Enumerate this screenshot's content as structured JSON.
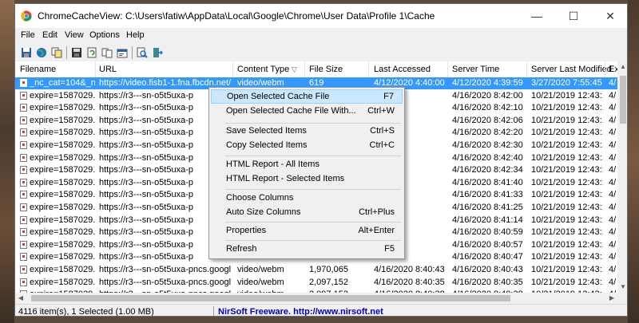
{
  "window": {
    "title": "ChromeCacheView:  C:\\Users\\fatiw\\AppData\\Local\\Google\\Chrome\\User Data\\Profile 1\\Cache"
  },
  "title_buttons": {
    "minimize": "—",
    "maximize": "☐",
    "close": "✕"
  },
  "menubar": [
    "File",
    "Edit",
    "View",
    "Options",
    "Help"
  ],
  "toolbar": [
    "save-icon",
    "globe-icon",
    "copy-icon",
    "disk-icon",
    "refresh-icon",
    "page-copy-icon",
    "properties-icon",
    "search-icon",
    "exit-icon"
  ],
  "columns": [
    "Filename",
    "URL",
    "Content Type",
    "File Size",
    "Last Accessed",
    "Server Time",
    "Server Last Modified",
    "Ex"
  ],
  "rows": [
    {
      "filename": "_nc_cat=104&_n...",
      "url": "https://video.fisb1-1.fna.fbcdn.net/...",
      "type": "video/webm",
      "size": "619",
      "accessed": "4/12/2020 4:40:00 ...",
      "server": "4/12/2020 4:39:59 ...",
      "modified": "3/27/2020 7:55:45 ...",
      "ex": "4/"
    },
    {
      "filename": "expire=1587029...",
      "url": "https://r3---sn-o5t5uxa-p",
      "type": "",
      "size": "",
      "accessed": "",
      "server": "4/16/2020 8:42:00 ...",
      "modified": "10/21/2019 12:43:1...",
      "ex": "4/"
    },
    {
      "filename": "expire=1587029...",
      "url": "https://r3---sn-o5t5uxa-p",
      "type": "",
      "size": "",
      "accessed": "",
      "server": "4/16/2020 8:42:10 ...",
      "modified": "10/21/2019 12:43:1...",
      "ex": "4/"
    },
    {
      "filename": "expire=1587029...",
      "url": "https://r3---sn-o5t5uxa-p",
      "type": "",
      "size": "",
      "accessed": "",
      "server": "4/16/2020 8:42:06 ...",
      "modified": "10/21/2019 12:43:1...",
      "ex": "4/"
    },
    {
      "filename": "expire=1587029...",
      "url": "https://r3---sn-o5t5uxa-p",
      "type": "",
      "size": "",
      "accessed": "",
      "server": "4/16/2020 8:42:20 ...",
      "modified": "10/21/2019 12:43:1...",
      "ex": "4/"
    },
    {
      "filename": "expire=1587029...",
      "url": "https://r3---sn-o5t5uxa-p",
      "type": "",
      "size": "",
      "accessed": "",
      "server": "4/16/2020 8:42:30 ...",
      "modified": "10/21/2019 12:43:1...",
      "ex": "4/"
    },
    {
      "filename": "expire=1587029...",
      "url": "https://r3---sn-o5t5uxa-p",
      "type": "",
      "size": "",
      "accessed": "",
      "server": "4/16/2020 8:42:40 ...",
      "modified": "10/21/2019 12:43:1...",
      "ex": "4/"
    },
    {
      "filename": "expire=1587029...",
      "url": "https://r3---sn-o5t5uxa-p",
      "type": "",
      "size": "",
      "accessed": "",
      "server": "4/16/2020 8:42:34 ...",
      "modified": "10/21/2019 12:43:1...",
      "ex": "4/"
    },
    {
      "filename": "expire=1587029...",
      "url": "https://r3---sn-o5t5uxa-p",
      "type": "",
      "size": "",
      "accessed": "",
      "server": "4/16/2020 8:41:40 ...",
      "modified": "10/21/2019 12:43:1...",
      "ex": "4/"
    },
    {
      "filename": "expire=1587029...",
      "url": "https://r3---sn-o5t5uxa-p",
      "type": "",
      "size": "",
      "accessed": "",
      "server": "4/16/2020 8:41:33 ...",
      "modified": "10/21/2019 12:43:1...",
      "ex": "4/"
    },
    {
      "filename": "expire=1587029...",
      "url": "https://r3---sn-o5t5uxa-p",
      "type": "",
      "size": "",
      "accessed": "",
      "server": "4/16/2020 8:41:25 ...",
      "modified": "10/21/2019 12:43:1...",
      "ex": "4/"
    },
    {
      "filename": "expire=1587029...",
      "url": "https://r3---sn-o5t5uxa-p",
      "type": "",
      "size": "",
      "accessed": "",
      "server": "4/16/2020 8:41:14 ...",
      "modified": "10/21/2019 12:43:1...",
      "ex": "4/"
    },
    {
      "filename": "expire=1587029...",
      "url": "https://r3---sn-o5t5uxa-p",
      "type": "",
      "size": "",
      "accessed": "",
      "server": "4/16/2020 8:40:59 ...",
      "modified": "10/21/2019 12:43:1...",
      "ex": "4/"
    },
    {
      "filename": "expire=1587029...",
      "url": "https://r3---sn-o5t5uxa-p",
      "type": "",
      "size": "",
      "accessed": "",
      "server": "4/16/2020 8:40:57 ...",
      "modified": "10/21/2019 12:43:1...",
      "ex": "4/"
    },
    {
      "filename": "expire=1587029...",
      "url": "https://r3---sn-o5t5uxa-p",
      "type": "",
      "size": "",
      "accessed": "",
      "server": "4/16/2020 8:40:47 ...",
      "modified": "10/21/2019 12:43:1...",
      "ex": "4/"
    },
    {
      "filename": "expire=1587029...",
      "url": "https://r3---sn-o5t5uxa-pncs.googl...",
      "type": "video/webm",
      "size": "1,970,065",
      "accessed": "4/16/2020 8:40:43 ...",
      "server": "4/16/2020 8:40:43 ...",
      "modified": "10/21/2019 12:43:1...",
      "ex": "4/"
    },
    {
      "filename": "expire=1587029...",
      "url": "https://r3---sn-o5t5uxa-pncs.googl...",
      "type": "video/webm",
      "size": "2,097,152",
      "accessed": "4/16/2020 8:40:35 ...",
      "server": "4/16/2020 8:40:35 ...",
      "modified": "10/21/2019 12:43:1...",
      "ex": "4/"
    },
    {
      "filename": "expire=1587029...",
      "url": "https://r3---sn-o5t5uxa-pncs.googl...",
      "type": "video/webm",
      "size": "2,097,152",
      "accessed": "4/16/2020 8:40:38 ...",
      "server": "4/16/2020 8:40:38 ...",
      "modified": "10/21/2019 12:43:1...",
      "ex": "4/"
    }
  ],
  "context_menu": [
    {
      "label": "Open Selected Cache File",
      "key": "F7"
    },
    {
      "label": "Open Selected Cache File With...",
      "key": "Ctrl+W"
    },
    {
      "label": "Save Selected Items",
      "key": "Ctrl+S"
    },
    {
      "label": "Copy Selected Items",
      "key": "Ctrl+C"
    },
    {
      "label": "HTML Report - All Items",
      "key": ""
    },
    {
      "label": "HTML Report - Selected Items",
      "key": ""
    },
    {
      "label": "Choose Columns",
      "key": ""
    },
    {
      "label": "Auto Size Columns",
      "key": "Ctrl+Plus"
    },
    {
      "label": "Properties",
      "key": "Alt+Enter"
    },
    {
      "label": "Refresh",
      "key": "F5"
    }
  ],
  "status": {
    "items": "4116 item(s), 1 Selected  (1.00 MB)",
    "link": "NirSoft Freeware.  http://www.nirsoft.net"
  },
  "colors": {
    "selection": "#3399ff",
    "menu_highlight": "#cce8ff",
    "link": "#0000c0"
  }
}
